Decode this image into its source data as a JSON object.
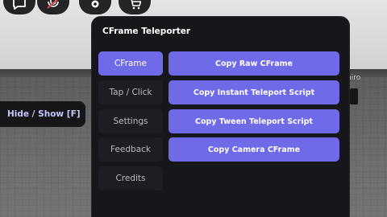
{
  "world": {
    "player_tag": "hiro"
  },
  "topbar": {
    "icons": [
      "chat-icon",
      "voice-mic-icon",
      "settings-gear-icon",
      "cart-icon"
    ]
  },
  "toggle": {
    "label": "Hide / Show [F]"
  },
  "panel": {
    "title": "CFrame Teleporter",
    "accent_color": "#6e6ae8",
    "tabs": [
      {
        "label": "CFrame",
        "active": true
      },
      {
        "label": "Tap / Click",
        "active": false
      },
      {
        "label": "Settings",
        "active": false
      },
      {
        "label": "Feedback",
        "active": false
      },
      {
        "label": "Credits",
        "active": false
      }
    ],
    "actions": [
      {
        "label": "Copy Raw CFrame"
      },
      {
        "label": "Copy Instant Teleport Script"
      },
      {
        "label": "Copy Tween Teleport Script"
      },
      {
        "label": "Copy Camera CFrame"
      }
    ]
  }
}
